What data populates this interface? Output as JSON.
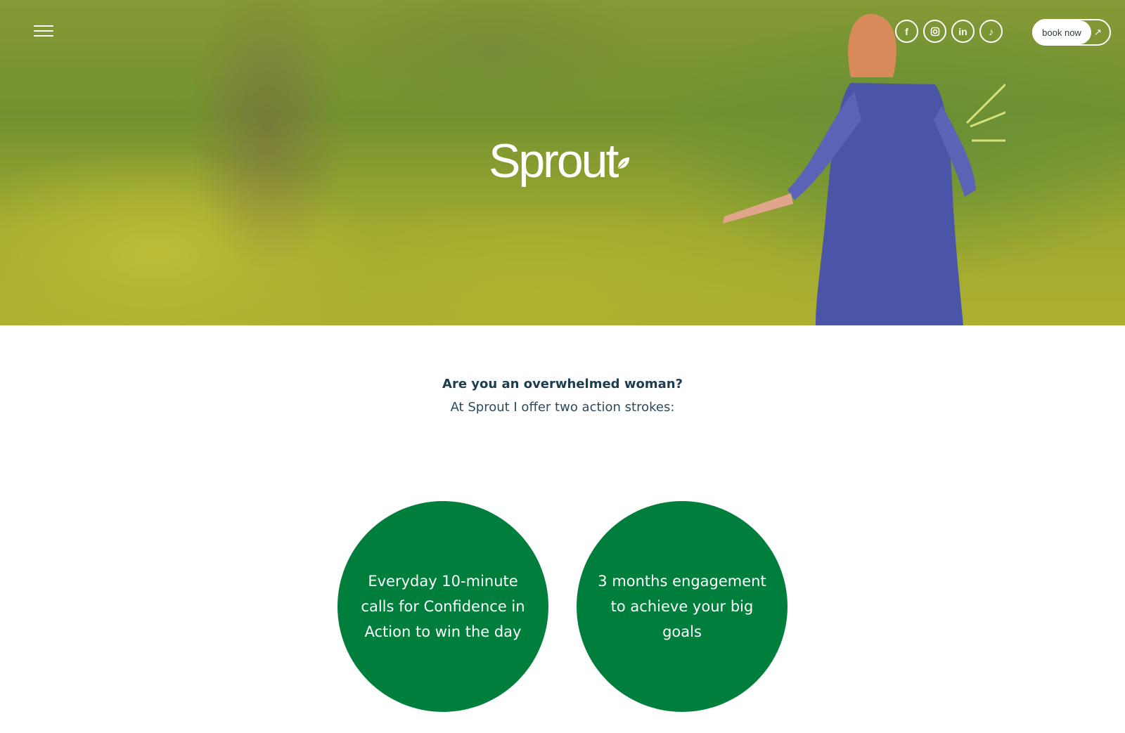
{
  "header": {
    "social_icons": [
      "facebook-icon",
      "instagram-icon",
      "linkedin-icon",
      "tiktok-icon"
    ],
    "book_label": "book now"
  },
  "hero": {
    "logo_text": "Sprout"
  },
  "intro": {
    "question": "Are you an overwhelmed woman?",
    "subtitle": "At Sprout I offer two action strokes:"
  },
  "offers": [
    {
      "text": "Everyday 10-minute calls for Confidence in Action to win the day"
    },
    {
      "text": "3 months engagement to achieve your big goals"
    }
  ],
  "colors": {
    "accent_green": "#007f3c",
    "heading_navy": "#1c3c4f"
  }
}
